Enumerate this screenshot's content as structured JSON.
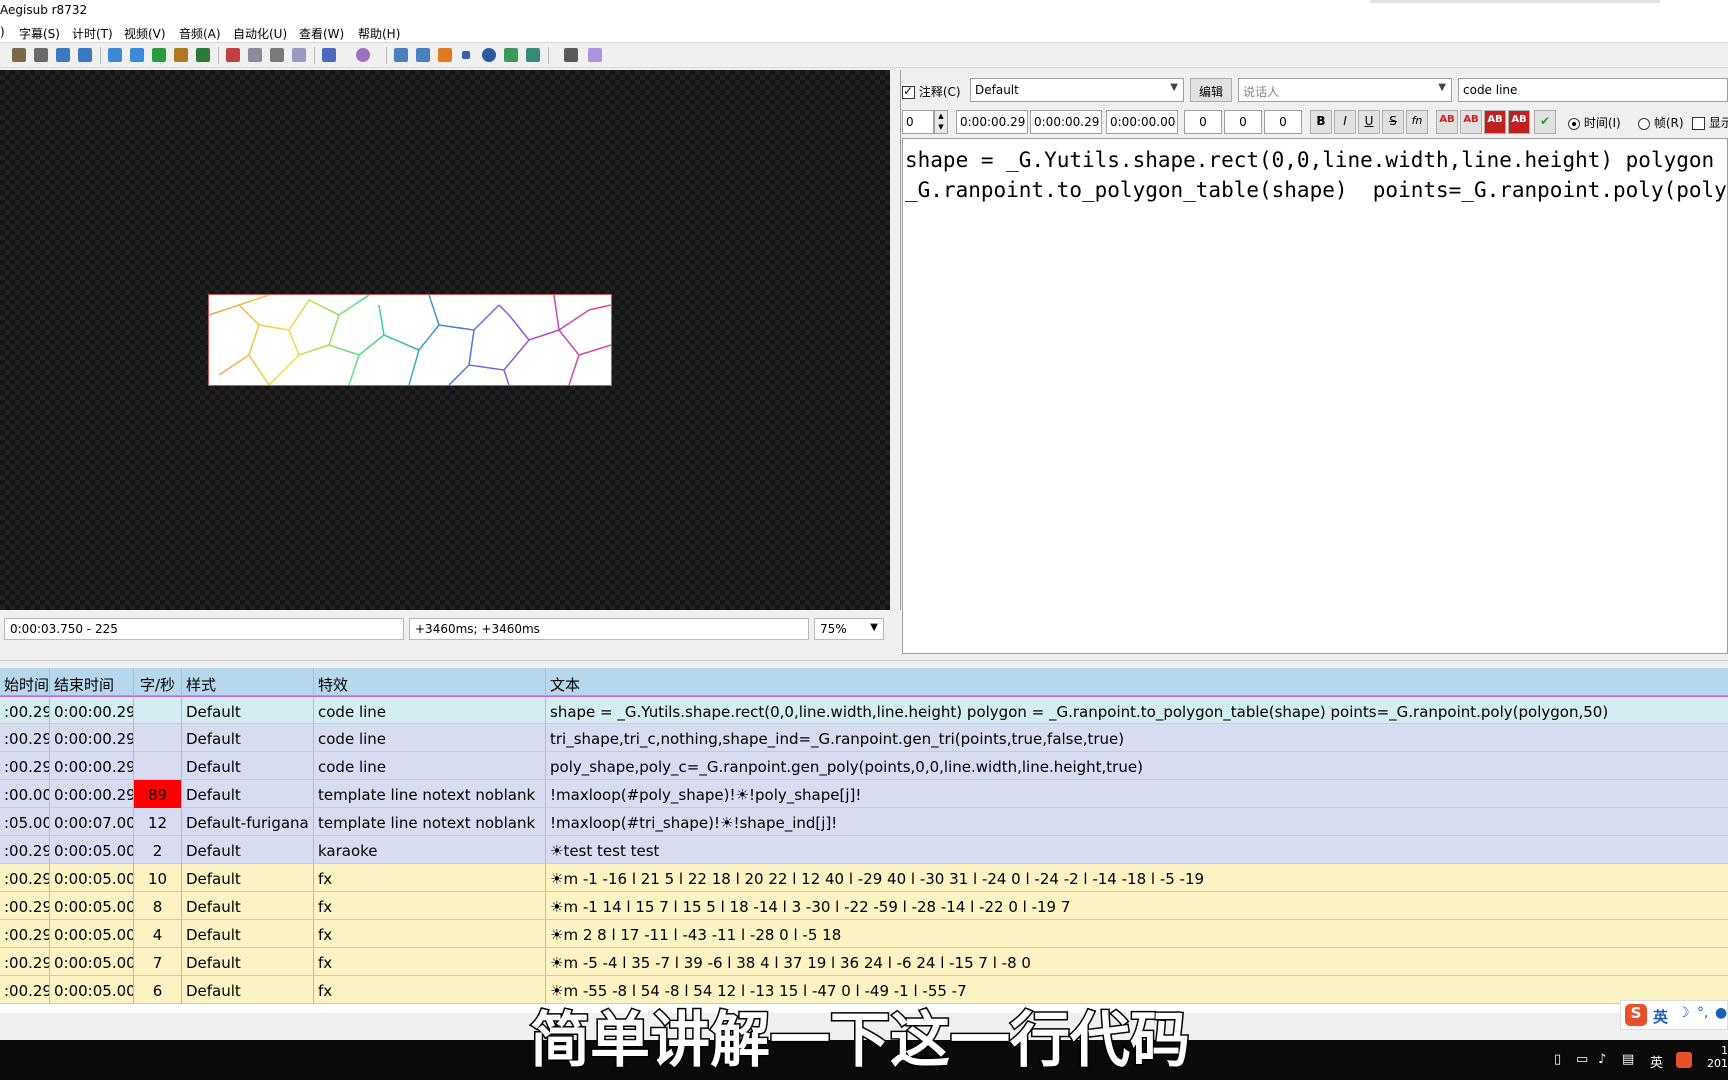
{
  "window": {
    "title": "Aegisub r8732"
  },
  "menu": [
    "字幕(S)",
    "计时(T)",
    "视频(V)",
    "音频(A)",
    "自动化(U)",
    "查看(W)",
    "帮助(H)"
  ],
  "menu_prefix": ")",
  "video_status": {
    "time": "0:00:03.750 - 225",
    "offset": "+3460ms; +3460ms",
    "zoom": "75%"
  },
  "edit": {
    "comment_label": "注释(C)",
    "comment_checked": true,
    "style": "Default",
    "edit_button": "编辑",
    "actor_placeholder": "说话人",
    "effect": "code line",
    "layer": "0",
    "start": "0:00:00.29",
    "end": "0:00:00.29",
    "duration": "0:00:00.00",
    "margin_l": "0",
    "margin_r": "0",
    "margin_v": "0",
    "fmt_buttons": [
      "B",
      "I",
      "U",
      "S",
      "fn"
    ],
    "color_buttons": [
      "AB",
      "AB",
      "AB",
      "AB"
    ],
    "time_radio": "时间(I)",
    "frame_radio": "帧(R)",
    "show_label": "显示",
    "text_lines": [
      "shape = _G.Yutils.shape.rect(0,0,line.width,line.height) polygon =",
      "_G.ranpoint.to_polygon_table(shape)  points=_G.ranpoint.poly(polygon,"
    ]
  },
  "grid": {
    "columns": [
      "始时间",
      "结束时间",
      "字/秒",
      "样式",
      "特效",
      "文本"
    ],
    "rows": [
      {
        "start": ":00.29",
        "end": "0:00:00.29",
        "cps": "",
        "style": "Default",
        "effect": "code line",
        "text": "shape = _G.Yutils.shape.rect(0,0,line.width,line.height) polygon = _G.ranpoint.to_polygon_table(shape)  points=_G.ranpoint.poly(polygon,50)",
        "kind": "selected"
      },
      {
        "start": ":00.29",
        "end": "0:00:00.29",
        "cps": "",
        "style": "Default",
        "effect": "code line",
        "text": "tri_shape,tri_c,nothing,shape_ind=_G.ranpoint.gen_tri(points,true,false,true)",
        "kind": "comment"
      },
      {
        "start": ":00.29",
        "end": "0:00:00.29",
        "cps": "",
        "style": "Default",
        "effect": "code line",
        "text": "poly_shape,poly_c=_G.ranpoint.gen_poly(points,0,0,line.width,line.height,true)",
        "kind": "comment"
      },
      {
        "start": ":00.00",
        "end": "0:00:00.29",
        "cps": "89",
        "style": "Default",
        "effect": "template line notext noblank",
        "text": "!maxloop(#poly_shape)!☀!poly_shape[j]!",
        "kind": "comment",
        "cps_alert": true
      },
      {
        "start": ":05.00",
        "end": "0:00:07.00",
        "cps": "12",
        "style": "Default-furigana",
        "effect": "template line notext noblank",
        "text": "!maxloop(#tri_shape)!☀!shape_ind[j]!",
        "kind": "comment"
      },
      {
        "start": ":00.29",
        "end": "0:00:05.00",
        "cps": "2",
        "style": "Default",
        "effect": "karaoke",
        "text": "☀test test test",
        "kind": "comment"
      },
      {
        "start": ":00.29",
        "end": "0:00:05.00",
        "cps": "10",
        "style": "Default",
        "effect": "fx",
        "text": "☀m -1 -16 l 21 5 l 22 18 l 20 22 l 12 40 l -29 40 l -30 31 l -24 0 l -24 -2 l -14 -18 l -5 -19",
        "kind": "fx"
      },
      {
        "start": ":00.29",
        "end": "0:00:05.00",
        "cps": "8",
        "style": "Default",
        "effect": "fx",
        "text": "☀m -1 14 l 15 7 l 15 5 l 18 -14 l 3 -30 l -22 -59 l -28 -14 l -22 0 l -19 7",
        "kind": "fx"
      },
      {
        "start": ":00.29",
        "end": "0:00:05.00",
        "cps": "4",
        "style": "Default",
        "effect": "fx",
        "text": "☀m 2 8 l 17 -11 l -43 -11 l -28 0 l -5 18",
        "kind": "fx"
      },
      {
        "start": ":00.29",
        "end": "0:00:05.00",
        "cps": "7",
        "style": "Default",
        "effect": "fx",
        "text": "☀m -5 -4 l 35 -7 l 39 -6 l 38 4 l 37 19 l 36 24 l -6 24 l -15 7 l -8 0",
        "kind": "fx"
      },
      {
        "start": ":00.29",
        "end": "0:00:05.00",
        "cps": "6",
        "style": "Default",
        "effect": "fx",
        "text": "☀m -55 -8 l 54 -8 l 54 12 l -13 15 l -47 0 l -49 -1 l -55 -7",
        "kind": "fx"
      }
    ]
  },
  "overlay_subtitle": "简单讲解一下这一行代码",
  "tray": {
    "ime": "英",
    "lang": "英",
    "clock": "1",
    "year": "201"
  },
  "colors": {
    "selected_row": "#d4edf1",
    "comment_row": "#d8dcf1",
    "fx_row": "#fbf3c4",
    "header": "#b7d7ec",
    "cps_alert": "#ff0000"
  }
}
